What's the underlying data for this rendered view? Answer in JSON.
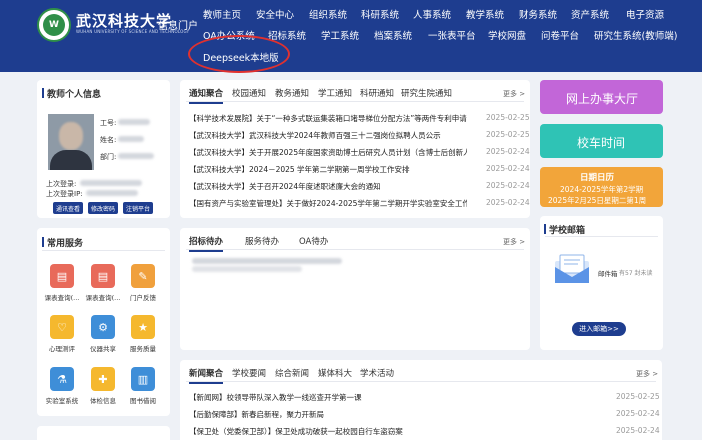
{
  "header": {
    "school_name": "武汉科技大学",
    "school_name_en": "WUHAN UNIVERSITY OF SCIENCE AND TECHNOLOGY",
    "portal_label": "信息门户",
    "nav_row1": [
      "教师主页",
      "安全中心",
      "组织系统",
      "科研系统",
      "人事系统",
      "教学系统",
      "财务系统",
      "资产系统",
      "电子资源"
    ],
    "nav_row2": [
      "OA办公系统",
      "招标系统",
      "学工系统",
      "档案系统",
      "一张表平台",
      "学校网盘",
      "问卷平台",
      "研究生系统(教师端)"
    ],
    "nav_row3": [
      "Deepseek本地版"
    ]
  },
  "profile": {
    "title": "教师个人信息",
    "fields": [
      "工号:",
      "姓名:",
      "部门:"
    ],
    "last_login_time_label": "上次登录:",
    "last_login_ip_label": "上次登录IP:",
    "buttons": [
      "通讯查看",
      "修改密码",
      "注销平台"
    ]
  },
  "notices": {
    "tabs": [
      "通知聚合",
      "校园通知",
      "教务通知",
      "学工通知",
      "科研通知",
      "研究生院通知"
    ],
    "more": "更多 >",
    "items": [
      {
        "text": "【科学技术发展院】关于“一种多式联运集装箱口堵导梯位分配方法”等两件专利申请权转让...",
        "date": "2025-02-25"
      },
      {
        "text": "【武汉科技大学】武汉科技大学2024年教师百强三十二强岗位拟聘人员公示",
        "date": "2025-02-25"
      },
      {
        "text": "【武汉科技大学】关于开展2025年度国家资助博士后研究人员计划（含博士后创新人才支持...",
        "date": "2025-02-24"
      },
      {
        "text": "【武汉科技大学】2024－2025 学年第二学期第一周学校工作安排",
        "date": "2025-02-24"
      },
      {
        "text": "【武汉科技大学】关于召开2024年度述职述廉大会的通知",
        "date": "2025-02-24"
      },
      {
        "text": "【国有资产与实验室管理处】关于做好2024-2025学年第二学期开学实验室安全工作的通知",
        "date": "2025-02-24"
      }
    ]
  },
  "tiles": {
    "online_hall": "网上办事大厅",
    "bus_time": "校车时间",
    "calendar_title": "日期日历",
    "calendar_term": "2024-2025学年第2学期",
    "calendar_week": "2025年2月25日星期二第1周"
  },
  "services": {
    "title": "常用服务",
    "items": [
      {
        "label": "课表查询(...",
        "color": "#e86a5a",
        "icon": "book-icon"
      },
      {
        "label": "课表查询(...",
        "color": "#e86a5a",
        "icon": "book-icon"
      },
      {
        "label": "门户反馈",
        "color": "#f0a03c",
        "icon": "feedback-icon"
      },
      {
        "label": "心理测评",
        "color": "#f5b82e",
        "icon": "heart-icon"
      },
      {
        "label": "仪器共享",
        "color": "#3e8ed8",
        "icon": "instrument-icon"
      },
      {
        "label": "服务质量",
        "color": "#f5b82e",
        "icon": "quality-icon"
      },
      {
        "label": "实验室系统",
        "color": "#3e8ed8",
        "icon": "lab-icon"
      },
      {
        "label": "体检信息",
        "color": "#f5b82e",
        "icon": "health-icon"
      },
      {
        "label": "图书借阅",
        "color": "#3e8ed8",
        "icon": "library-icon"
      }
    ]
  },
  "tasks": {
    "tabs": [
      "招标待办",
      "服务待办",
      "OA待办"
    ],
    "more": "更多 >"
  },
  "mail": {
    "title": "学校邮箱",
    "inbox_label": "邮件箱",
    "unread": "有57 封未读",
    "button": "进入邮箱>>"
  },
  "news": {
    "tabs": [
      "新闻聚合",
      "学校要闻",
      "综合新闻",
      "媒体科大",
      "学术活动"
    ],
    "more": "更多 >",
    "items": [
      {
        "text": "【新闻网】校领导带队深入教学一线巡查开学第一课",
        "date": "2025-02-25"
      },
      {
        "text": "【后勤保障部】新春启新程，聚力开新局",
        "date": "2025-02-24"
      },
      {
        "text": "【保卫处（党委保卫部）】保卫处成功破获一起校园自行车盗窃案",
        "date": "2025-02-24"
      }
    ]
  },
  "colors": {
    "header_bg": "#1e3d8f",
    "tile_online": "#c266d8",
    "tile_bus": "#2fc3b5",
    "tile_calendar": "#f2a53a",
    "highlight_circle": "#e0312f"
  }
}
